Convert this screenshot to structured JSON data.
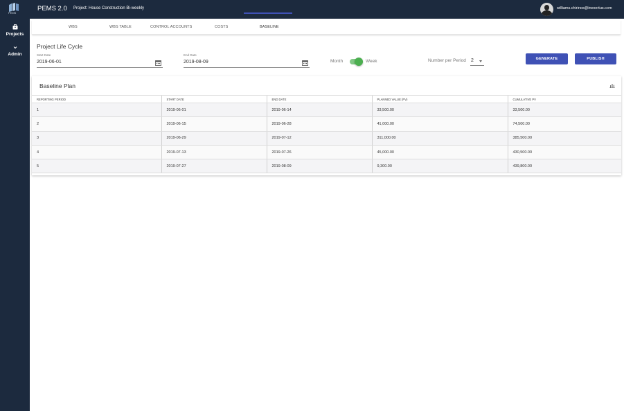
{
  "app": {
    "logo_text": "PEMS",
    "title": "PEMS 2.0",
    "project_title": "Project: House Construction Bi-weekly",
    "user_email": "williams.chirinos@inexertus.com"
  },
  "sidebar": {
    "items": [
      {
        "label": "Projects",
        "icon": "briefcase-icon"
      },
      {
        "label": "Admin",
        "icon": "chevron-down-icon"
      }
    ]
  },
  "tabs": [
    {
      "label": "WBS"
    },
    {
      "label": "WBS TABLE"
    },
    {
      "label": "CONTROL ACCOUNTS"
    },
    {
      "label": "COSTS"
    },
    {
      "label": "BASELINE",
      "active": true
    }
  ],
  "life_cycle": {
    "title": "Project Life Cycle",
    "start_label": "Start Date",
    "start_value": "2019-06-01",
    "end_label": "End Date",
    "end_value": "2019-08-09",
    "toggle_left": "Month",
    "toggle_right": "Week",
    "toggle_on": true,
    "npp_label": "Number per Period",
    "npp_value": "2",
    "generate_label": "GENERATE",
    "publish_label": "PUBLISH"
  },
  "baseline": {
    "title": "Baseline Plan",
    "columns": [
      "REPORTING PERIOD",
      "START DATE",
      "END DATE",
      "PLANNED VALUE (PV)",
      "CUMULATIVE PV"
    ],
    "rows": [
      [
        "1",
        "2019-06-01",
        "2019-06-14",
        "33,500.00",
        "33,500.00"
      ],
      [
        "2",
        "2019-06-15",
        "2019-06-28",
        "41,000.00",
        "74,500.00"
      ],
      [
        "3",
        "2019-06-29",
        "2019-07-12",
        "311,000.00",
        "385,500.00"
      ],
      [
        "4",
        "2019-07-13",
        "2019-07-26",
        "45,000.00",
        "430,500.00"
      ],
      [
        "5",
        "2019-07-27",
        "2019-08-09",
        "9,300.00",
        "439,800.00"
      ]
    ]
  },
  "colors": {
    "nav_bg": "#1c2a3e",
    "accent": "#3f51b5",
    "toggle": "#4caf50"
  }
}
